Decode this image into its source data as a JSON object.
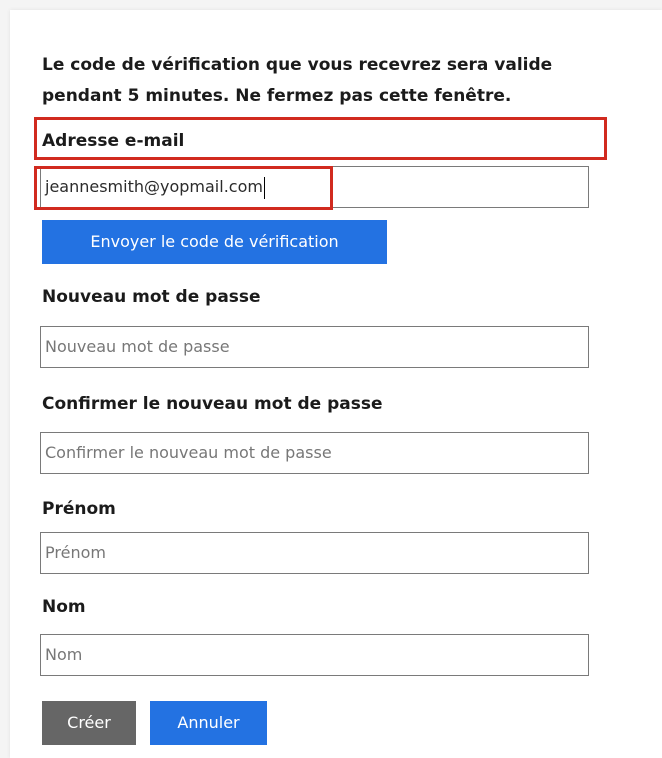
{
  "intro_text": "Le code de vérification que vous recevrez sera valide pendant 5 minutes. Ne fermez pas cette fenêtre.",
  "email": {
    "label": "Adresse e-mail",
    "value": "jeannesmith@yopmail.com"
  },
  "send_code_button": "Envoyer le code de vérification",
  "new_password": {
    "label": "Nouveau mot de passe",
    "placeholder": "Nouveau mot de passe"
  },
  "confirm_password": {
    "label": "Confirmer le nouveau mot de passe",
    "placeholder": "Confirmer le nouveau mot de passe"
  },
  "first_name": {
    "label": "Prénom",
    "placeholder": "Prénom"
  },
  "last_name": {
    "label": "Nom",
    "placeholder": "Nom"
  },
  "buttons": {
    "create": "Créer",
    "cancel": "Annuler"
  },
  "colors": {
    "primary": "#2372e2",
    "secondary": "#666666",
    "highlight": "#d12a1f"
  }
}
